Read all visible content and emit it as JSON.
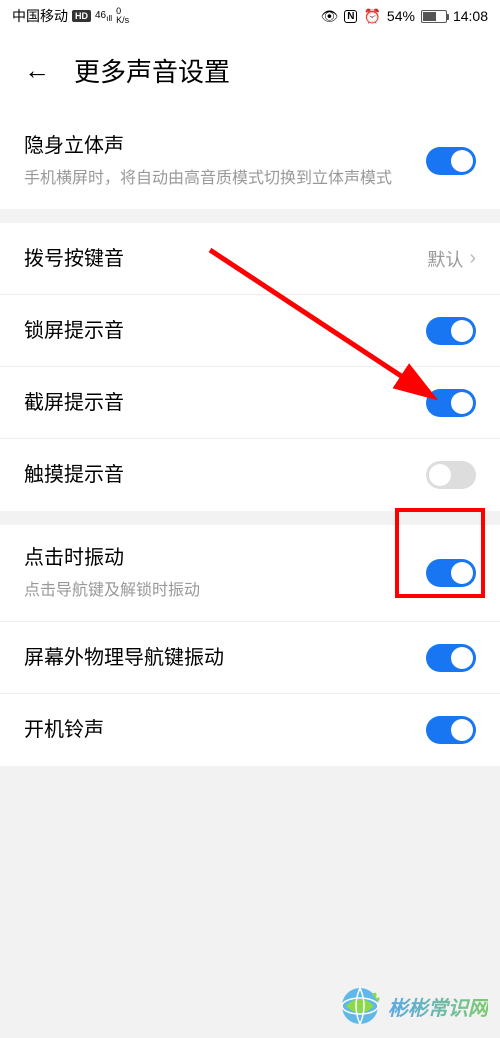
{
  "statusBar": {
    "carrier": "中国移动",
    "hdBadge": "HD",
    "signal": "46",
    "speed": "0",
    "speedUnit": "K/s",
    "batteryPercent": "54%",
    "time": "14:08"
  },
  "header": {
    "title": "更多声音设置"
  },
  "section1": {
    "stereo": {
      "title": "隐身立体声",
      "subtitle": "手机横屏时，将自动由高音质模式切换到立体声模式",
      "enabled": true
    }
  },
  "section2": {
    "dialTone": {
      "title": "拨号按键音",
      "value": "默认"
    },
    "lockSound": {
      "title": "锁屏提示音",
      "enabled": true
    },
    "screenshotSound": {
      "title": "截屏提示音",
      "enabled": true
    },
    "touchSound": {
      "title": "触摸提示音",
      "enabled": false
    }
  },
  "section3": {
    "tapVibrate": {
      "title": "点击时振动",
      "subtitle": "点击导航键及解锁时振动",
      "enabled": true
    },
    "navKeyVibrate": {
      "title": "屏幕外物理导航键振动",
      "enabled": true
    },
    "bootSound": {
      "title": "开机铃声",
      "enabled": true
    }
  },
  "watermark": {
    "text": "彬彬常识网"
  }
}
